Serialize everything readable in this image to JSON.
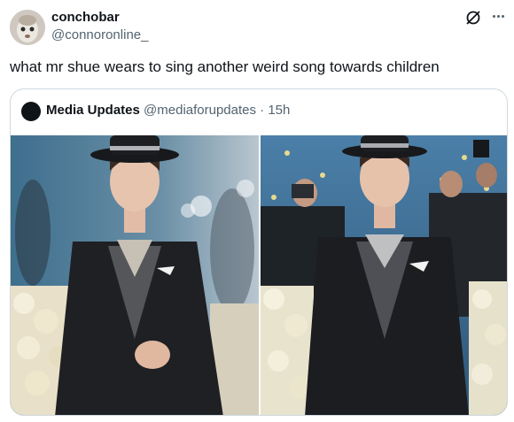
{
  "post": {
    "display_name": "conchobar",
    "handle": "@connoronline_",
    "text": "what mr shue wears to sing another weird song towards children"
  },
  "quoted_post": {
    "display_name": "Media Updates",
    "handle": "@mediaforupdates",
    "separator": " · ",
    "time": "15h"
  },
  "icons": {
    "grok": "grok-icon",
    "more": "more-icon"
  },
  "colors": {
    "text_primary": "#0f1419",
    "text_secondary": "#536471",
    "border": "#cfd9de"
  }
}
